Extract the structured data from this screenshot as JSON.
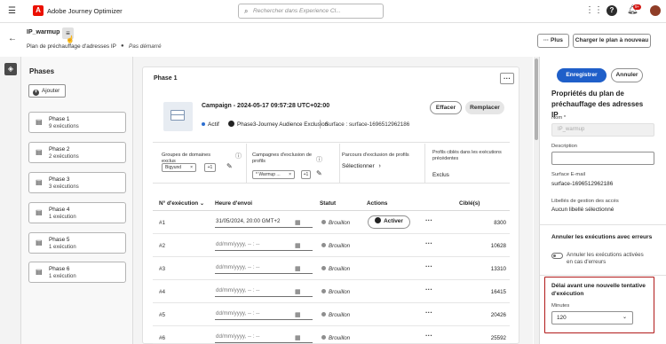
{
  "app": {
    "title": "Adobe Journey Optimizer",
    "logo_letter": "A"
  },
  "search": {
    "placeholder": "Rechercher dans Experience Cl..."
  },
  "topbar": {
    "notifications": "9+"
  },
  "header": {
    "name": "IP_warmup",
    "subtitle": "Plan de préchauffage d'adresses IP",
    "status": "Pas démarré",
    "plus_label": "Plus",
    "reload_label": "Charger le plan à nouveau"
  },
  "phases_panel": {
    "title": "Phases",
    "add_label": "Ajouter",
    "items": [
      {
        "name": "Phase 1",
        "count": "9 exécutions"
      },
      {
        "name": "Phase 2",
        "count": "2 exécutions"
      },
      {
        "name": "Phase 3",
        "count": "3 exécutions"
      },
      {
        "name": "Phase 4",
        "count": "1 exécution"
      },
      {
        "name": "Phase 5",
        "count": "1 exécution"
      },
      {
        "name": "Phase 6",
        "count": "1 exécution"
      }
    ]
  },
  "phase": {
    "title": "Phase 1",
    "campaign": {
      "title": "Campaign - 2024-05-17 09:57:28 UTC+02:00",
      "status": "Actif",
      "audience": "Phase3-Journey Audience Exclusion",
      "surface": "Surface : surface-1696512962186",
      "clear_label": "Effacer",
      "replace_label": "Remplacer"
    },
    "filters": {
      "excluded_domains_label": "Groupes de domaines exclus",
      "excluded_domains_tag": "Bigyund",
      "excluded_domains_count": "+1",
      "excluded_campaigns_label": "Campagnes d'exclusion de profils",
      "excluded_campaigns_tag": "* Warmup ...",
      "excluded_campaigns_count": "+1",
      "journey_exclusion_label": "Parcours d'exclusion de profils",
      "journey_exclusion_action": "Sélectionner",
      "targeted_profiles_label": "Profils ciblés dans les exécutions précédentes",
      "targeted_profiles_value": "Exclus"
    },
    "table": {
      "headers": {
        "run": "N° d'exécution",
        "send_time": "Heure d'envoi",
        "status": "Statut",
        "actions": "Actions",
        "target": "Ciblé(s)"
      },
      "activate_label": "Activer",
      "rows": [
        {
          "num": "#1",
          "date": "31/05/2024, 20:00 GMT+2",
          "status": "Brouillon",
          "target": "8300"
        },
        {
          "num": "#2",
          "date": "dd/mm/yyyy, -- : --",
          "status": "Brouillon",
          "target": "10628"
        },
        {
          "num": "#3",
          "date": "dd/mm/yyyy, -- : --",
          "status": "Brouillon",
          "target": "13310"
        },
        {
          "num": "#4",
          "date": "dd/mm/yyyy, -- : --",
          "status": "Brouillon",
          "target": "16415"
        },
        {
          "num": "#5",
          "date": "dd/mm/yyyy, -- : --",
          "status": "Brouillon",
          "target": "20426"
        },
        {
          "num": "#6",
          "date": "dd/mm/yyyy, -- : --",
          "status": "Brouillon",
          "target": "25592"
        }
      ]
    }
  },
  "properties": {
    "save_label": "Enregistrer",
    "cancel_label": "Annuler",
    "title": "Propriétés du plan de préchauffage des adresses IP",
    "name_label": "Nom *",
    "name_value": "IP_warmup",
    "description_label": "Description",
    "surface_label": "Surface E-mail",
    "surface_value": "surface-1696512962186",
    "access_label": "Libellés de gestion des accès",
    "access_value": "Aucun libellé sélectionné",
    "cancel_runs_title": "Annuler les exécutions avec erreurs",
    "cancel_runs_toggle": "Annuler les exécutions activées en cas d'erreurs",
    "retry_title": "Délai avant une nouvelle tentative d'exécution",
    "minutes_label": "Minutes",
    "minutes_value": "120"
  }
}
